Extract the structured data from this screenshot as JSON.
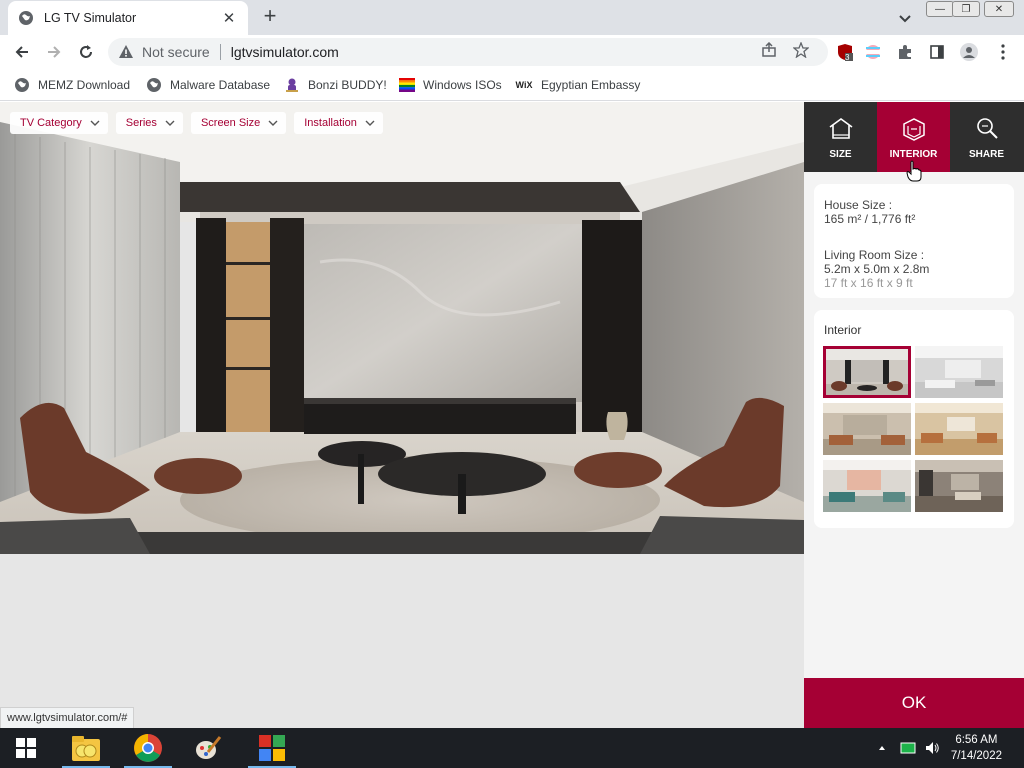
{
  "browser": {
    "tab": {
      "title": "LG TV Simulator"
    },
    "address": {
      "security_label": "Not secure",
      "url": "lgtvsimulator.com"
    },
    "extensions_badge": "3",
    "bookmarks": [
      {
        "label": "MEMZ Download",
        "icon": "globe-icon"
      },
      {
        "label": "Malware Database",
        "icon": "globe-icon"
      },
      {
        "label": "Bonzi BUDDY!",
        "icon": "bonzi-icon"
      },
      {
        "label": "Windows ISOs",
        "icon": "windows-flag-icon"
      },
      {
        "label": "Egyptian Embassy",
        "icon": "wix-icon"
      }
    ],
    "status_url": "www.lgtvsimulator.com/#"
  },
  "page": {
    "filters": [
      {
        "label": "TV Category"
      },
      {
        "label": "Series"
      },
      {
        "label": "Screen Size"
      },
      {
        "label": "Installation"
      }
    ],
    "panel": {
      "tabs": [
        {
          "label": "SIZE",
          "icon": "house-icon"
        },
        {
          "label": "INTERIOR",
          "icon": "interior-cube-icon"
        },
        {
          "label": "SHARE",
          "icon": "search-share-icon"
        }
      ],
      "active_tab": "INTERIOR",
      "house_size_label": "House Size :",
      "house_size_value": "165 m² / 1,776 ft²",
      "living_room_label": "Living Room Size :",
      "living_room_metric": "5.2m x 5.0m x 2.8m",
      "living_room_imperial": "17 ft x 16 ft x 9 ft",
      "interior_title": "Interior",
      "interior_options": 6,
      "selected_interior": 0,
      "ok_label": "OK"
    }
  },
  "taskbar": {
    "time": "6:56 AM",
    "date": "7/14/2022"
  },
  "colors": {
    "brand": "#a50034",
    "panel_dark": "#2e2e2e",
    "taskbar": "#1c1f24"
  }
}
